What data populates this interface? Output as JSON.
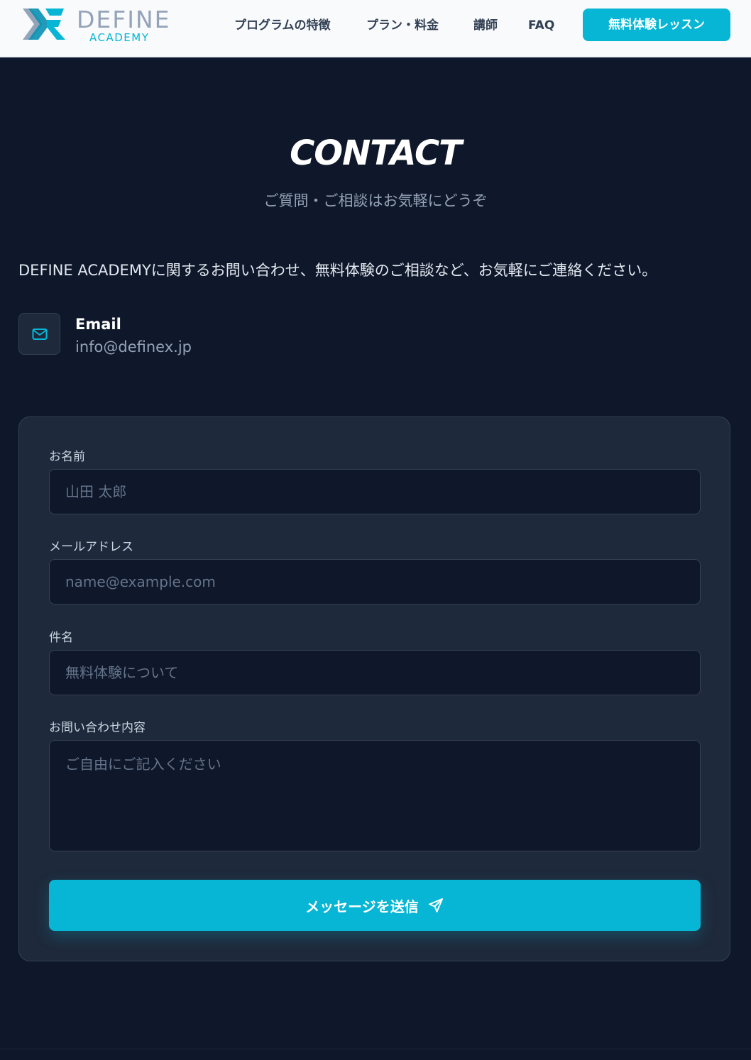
{
  "header": {
    "logo": {
      "name": "DEFINE",
      "sub": "ACADEMY"
    },
    "nav": [
      {
        "label": "プログラムの特徴"
      },
      {
        "label": "プラン・料金"
      },
      {
        "label": "講師"
      },
      {
        "label": "FAQ"
      }
    ],
    "cta_label": "無料体験レッスン"
  },
  "hero": {
    "title": "CONTACT",
    "subtitle": "ご質問・ご相談はお気軽にどうぞ",
    "intro": "DEFINE ACADEMYに関するお問い合わせ、無料体験のご相談など、お気軽にご連絡ください。"
  },
  "contact": {
    "email_label": "Email",
    "email_value": "info@definex.jp",
    "icon": "mail-icon"
  },
  "form": {
    "name": {
      "label": "お名前",
      "placeholder": "山田 太郎",
      "value": ""
    },
    "email": {
      "label": "メールアドレス",
      "placeholder": "name@example.com",
      "value": ""
    },
    "subject": {
      "label": "件名",
      "placeholder": "無料体験について",
      "value": ""
    },
    "message": {
      "label": "お問い合わせ内容",
      "placeholder": "ご自由にご記入ください",
      "value": ""
    },
    "submit_label": "メッセージを送信",
    "submit_icon": "send-icon"
  },
  "colors": {
    "accent": "#06b6d4",
    "background": "#0f172a",
    "card": "#1e293b",
    "header": "#f8fafc"
  }
}
